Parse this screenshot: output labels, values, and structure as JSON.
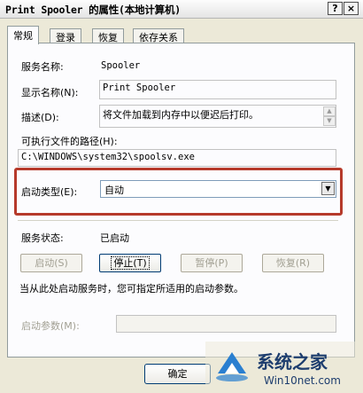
{
  "window": {
    "title": "Print Spooler 的属性(本地计算机)",
    "help_btn": "?",
    "close_btn": "×"
  },
  "tabs": [
    "常规",
    "登录",
    "恢复",
    "依存关系"
  ],
  "general": {
    "service_name_label": "服务名称:",
    "service_name_value": "Spooler",
    "display_name_label": "显示名称(N):",
    "display_name_value": "Print Spooler",
    "description_label": "描述(D):",
    "description_value": "将文件加载到内存中以便迟后打印。",
    "exe_path_label": "可执行文件的路径(H):",
    "exe_path_value": "C:\\WINDOWS\\system32\\spoolsv.exe",
    "startup_type_label": "启动类型(E):",
    "startup_type_value": "自动",
    "service_status_label": "服务状态:",
    "service_status_value": "已启动",
    "buttons": {
      "start": "启动(S)",
      "stop": "停止(T)",
      "pause": "暂停(P)",
      "resume": "恢复(R)"
    },
    "hint": "当从此处启动服务时，您可指定所适用的启动参数。",
    "start_params_label": "启动参数(M):",
    "start_params_value": ""
  },
  "footer": {
    "ok": "确定"
  },
  "watermark": {
    "brand": "系统之家",
    "site": "Win10net.com"
  },
  "colors": {
    "highlight": "#b63a2b",
    "dialog_bg": "#ece9d8",
    "panel_bg": "#fcfcfe"
  }
}
